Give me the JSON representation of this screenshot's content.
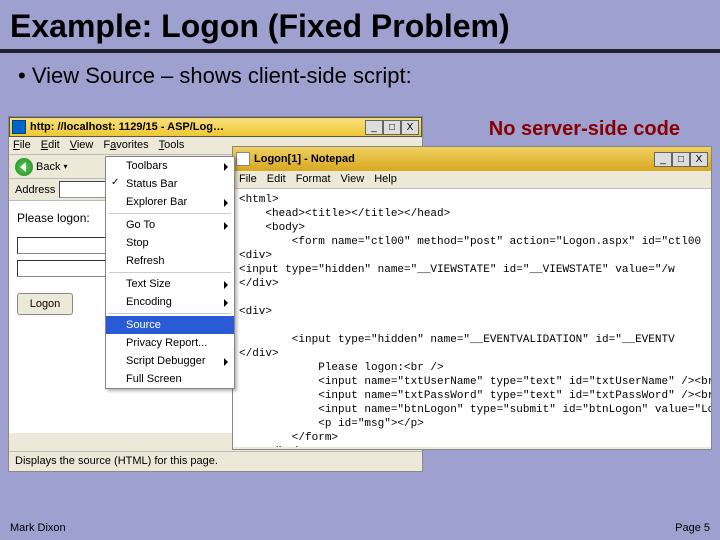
{
  "title": "Example: Logon (Fixed Problem)",
  "bullet": "View Source – shows client-side script:",
  "callout": "No server-side code",
  "footer": {
    "author": "Mark Dixon",
    "page": "Page 5"
  },
  "ie": {
    "title": "http: //localhost: 1129/15 - ASP/Log…",
    "menu": {
      "file": "File",
      "edit": "Edit",
      "view": "View",
      "favorites": "Favorites",
      "tools": "Tools"
    },
    "back": "Back",
    "addressLabel": "Address",
    "bodyLabel": "Please logon:",
    "logonBtn": "Logon",
    "status": "Displays the source (HTML) for this page."
  },
  "winbtn": {
    "min": "_",
    "max": "□",
    "close": "X"
  },
  "viewMenu": {
    "toolbars": "Toolbars",
    "statusbar": "Status Bar",
    "explorer": "Explorer Bar",
    "goto": "Go To",
    "stop": "Stop",
    "refresh": "Refresh",
    "textsize": "Text Size",
    "encoding": "Encoding",
    "source": "Source",
    "privacy": "Privacy Report...",
    "debugger": "Script Debugger",
    "fullscreen": "Full Screen"
  },
  "notepad": {
    "title": "Logon[1] - Notepad",
    "menu": {
      "file": "File",
      "edit": "Edit",
      "format": "Format",
      "view": "View",
      "help": "Help"
    },
    "code": "<html>\n    <head><title></title></head>\n    <body>\n        <form name=\"ctl00\" method=\"post\" action=\"Logon.aspx\" id=\"ctl00\n<div>\n<input type=\"hidden\" name=\"__VIEWSTATE\" id=\"__VIEWSTATE\" value=\"/w\n</div>\n\n<div>\n\n        <input type=\"hidden\" name=\"__EVENTVALIDATION\" id=\"__EVENTV\n</div>\n            Please logon:<br />\n            <input name=\"txtUserName\" type=\"text\" id=\"txtUserName\" /><br\n            <input name=\"txtPassWord\" type=\"text\" id=\"txtPassWord\" /><br\n            <input name=\"btnLogon\" type=\"submit\" id=\"btnLogon\" value=\"Lo\n            <p id=\"msg\"></p>\n        </form>\n    </body>\n</html>"
  }
}
